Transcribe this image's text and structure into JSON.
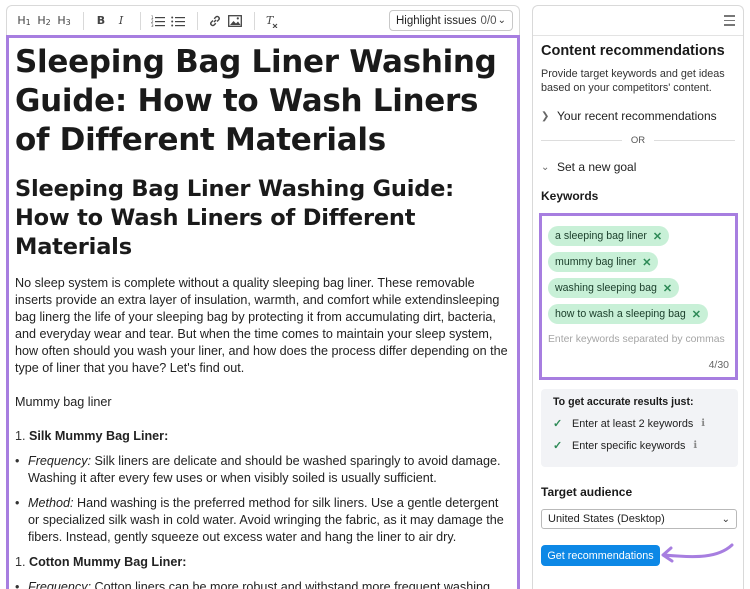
{
  "toolbar": {
    "h1": "H1",
    "h2": "H2",
    "h3": "H3",
    "bold": "B",
    "italic": "I",
    "ordered_list_icon": "ordered-list-icon",
    "bullet_list_icon": "bullet-list-icon",
    "link_icon": "link-icon",
    "image_icon": "image-icon",
    "clear_format_icon": "clear-format-icon",
    "highlight_label": "Highlight issues",
    "highlight_count": "0/0"
  },
  "editor": {
    "title": "Sleeping Bag Liner Washing Guide: How to Wash Liners of Different Materials",
    "heading": "Sleeping Bag Liner Washing Guide: How to Wash Liners of Different Materials",
    "intro": "No sleep system is complete without a quality sleeping bag liner. These removable inserts provide an extra layer of insulation, warmth, and comfort while extendinsleeping bag linerg the life of your sleeping bag by protecting it from accumulating dirt, bacteria, and everyday wear and tear. But when the time comes to maintain your sleep system, how often should you wash your liner, and how does the process differ depending on the type of liner that you have? Let's find out.",
    "subtitle": "Mummy bag liner",
    "items": [
      {
        "number": "1.",
        "title": "Silk Mummy Bag Liner:",
        "bullets": [
          {
            "label": "Frequency:",
            "text": " Silk liners are delicate and should be washed sparingly to avoid damage. Washing it after every few uses or when visibly soiled is usually sufficient."
          },
          {
            "label": "Method:",
            "text": " Hand washing is the preferred method for silk liners. Use a gentle detergent or specialized silk wash in cold water. Avoid wringing the fabric, as it may damage the fibers. Instead, gently squeeze out excess water and hang the liner to air dry."
          }
        ]
      },
      {
        "number": "1.",
        "title": "Cotton Mummy Bag Liner:",
        "bullets": [
          {
            "label": "Frequency:",
            "text": " Cotton liners can be more robust and withstand more frequent washing. Washing after every camping trip or every couple of uses is generally acceptable."
          }
        ]
      }
    ]
  },
  "panel": {
    "title": "Content recommendations",
    "description": "Provide target keywords and get ideas based on your competitors' content.",
    "recent": "Your recent recommendations",
    "or": "OR",
    "goal": "Set a new goal",
    "keywords_label": "Keywords",
    "keywords": [
      "a sleeping bag liner",
      "mummy bag liner",
      "washing sleeping bag",
      "how to wash a sleeping bag"
    ],
    "keywords_placeholder": "Enter keywords separated by commas",
    "keywords_count": "4/30",
    "tips_title": "To get accurate results just:",
    "tips": [
      "Enter at least 2 keywords",
      "Enter specific keywords"
    ],
    "audience_label": "Target audience",
    "audience_value": "United States (Desktop)",
    "button": "Get recommendations"
  },
  "colors": {
    "accent_purple": "#a77ee0",
    "chip_green": "#c8f0d7",
    "button_blue": "#0d88e6"
  }
}
